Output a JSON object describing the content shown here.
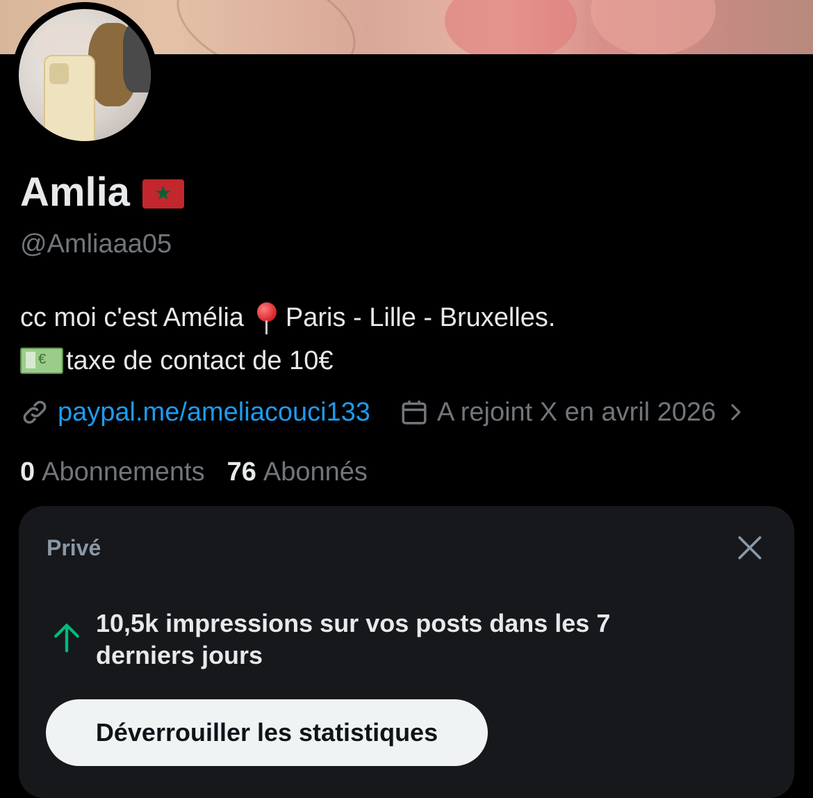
{
  "profile": {
    "name": "Amlia",
    "flag": "morocco-flag-icon",
    "handle": "@Amliaaa05",
    "bio_line1_before": "cc moi c'est Amélia",
    "bio_line1_after": "Paris - Lille - Bruxelles.",
    "bio_line2": "taxe de contact de 10€",
    "website": "paypal.me/ameliacouci133",
    "joined": "A rejoint X en avril 2026",
    "following_count": "0",
    "following_label": "Abonnements",
    "followers_count": "76",
    "followers_label": "Abonnés"
  },
  "insights_card": {
    "label": "Privé",
    "message": "10,5k impressions sur vos posts dans les 7 derniers jours",
    "button_label": "Déverrouiller les statistiques"
  },
  "colors": {
    "background": "#000000",
    "accent_link": "#1d9bf0",
    "muted_text": "#71767b",
    "card_bg": "#16181c",
    "up_arrow": "#00ba7c"
  }
}
